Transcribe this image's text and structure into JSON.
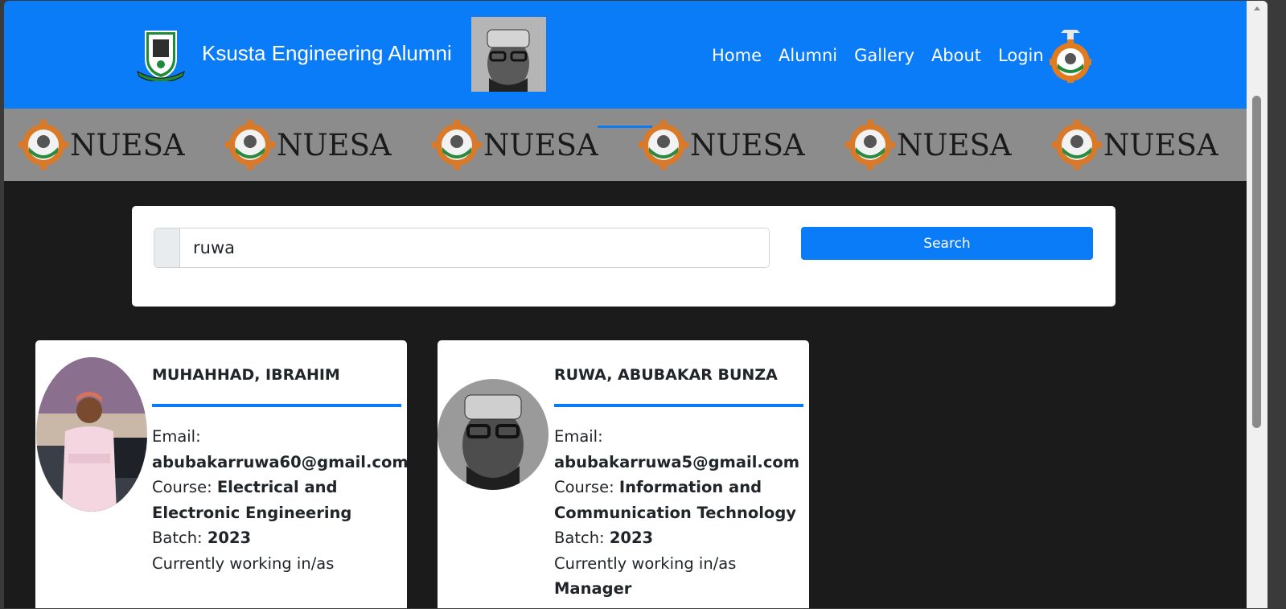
{
  "header": {
    "brand": "Ksusta Engineering Alumni",
    "nav": [
      "Home",
      "Alumni",
      "Gallery",
      "About",
      "Login"
    ]
  },
  "banner": {
    "text": "NUESA",
    "repeat": 6
  },
  "search": {
    "value": "ruwa",
    "button_label": "Search"
  },
  "alumni": [
    {
      "name": "MUHAHHAD, IBRAHIM",
      "email_label": "Email:",
      "email": "abubakarruwa60@gmail.com",
      "course_label": "Course:",
      "course": "Electrical and Electronic Engineering",
      "batch_label": "Batch:",
      "batch": "2023",
      "working_label": "Currently working in/as",
      "working": ""
    },
    {
      "name": "RUWA, ABUBAKAR BUNZA",
      "email_label": "Email:",
      "email": "abubakarruwa5@gmail.com",
      "course_label": "Course:",
      "course": "Information and Communication Technology",
      "batch_label": "Batch:",
      "batch": "2023",
      "working_label": "Currently working in/as",
      "working": "Manager"
    }
  ],
  "colors": {
    "primary": "#0b7cf7",
    "page_bg": "#1b1b1b",
    "banner_bg": "#8c8c8c"
  },
  "icons": [
    "university-logo-icon",
    "nuesa-gear-icon",
    "nuesa-banner-logo-icon"
  ]
}
